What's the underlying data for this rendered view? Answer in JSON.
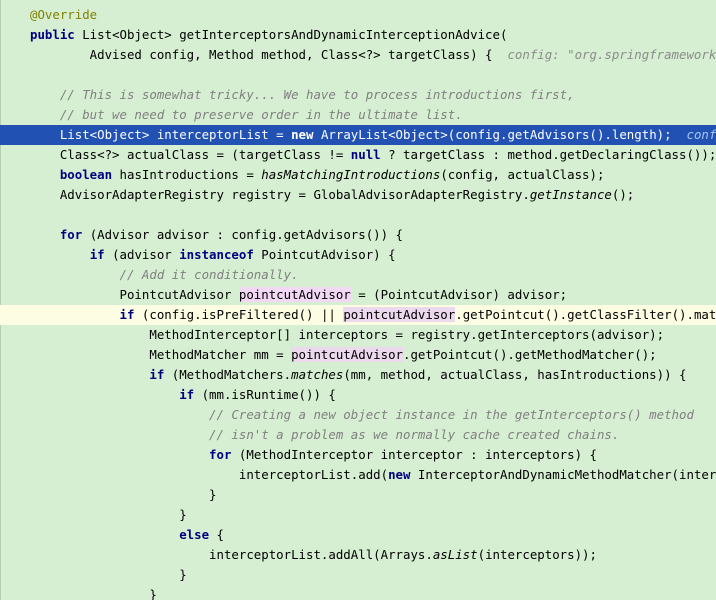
{
  "lines": [
    {
      "segs": [
        {
          "t": "@Override",
          "c": "ann"
        }
      ]
    },
    {
      "segs": [
        {
          "t": "public",
          "c": "kw"
        },
        {
          "t": " List<Object> getInterceptorsAndDynamicInterceptionAdvice("
        }
      ]
    },
    {
      "segs": [
        {
          "t": "        Advised config, Method method, Class<?> targetClass) {  "
        },
        {
          "t": "config: \"org.springframework.aop.framework.ProxyFactory",
          "c": "hint"
        }
      ]
    },
    {
      "segs": []
    },
    {
      "segs": [
        {
          "t": "    // This is somewhat tricky... We have to process introductions first,",
          "c": "cmt"
        }
      ]
    },
    {
      "segs": [
        {
          "t": "    // but we need to preserve order in the ultimate list.",
          "c": "cmt"
        }
      ]
    },
    {
      "state": "current",
      "segs": [
        {
          "t": "    List<Object> interceptorList = "
        },
        {
          "t": "new",
          "c": "kw"
        },
        {
          "t": " ArrayList<Object>(config.getAdvisors()."
        },
        {
          "t": "length",
          "c": "fld"
        },
        {
          "t": ");  "
        },
        {
          "t": "config: \"org.springframework",
          "c": "hint"
        }
      ]
    },
    {
      "segs": [
        {
          "t": "    Class<?> actualClass = (targetClass != "
        },
        {
          "t": "null",
          "c": "kw"
        },
        {
          "t": " ? targetClass : method.getDeclaringClass());"
        }
      ]
    },
    {
      "segs": [
        {
          "t": "    "
        },
        {
          "t": "boolean",
          "c": "kw"
        },
        {
          "t": " hasIntroductions = "
        },
        {
          "t": "hasMatchingIntroductions",
          "c": "it"
        },
        {
          "t": "(config, actualClass);"
        }
      ]
    },
    {
      "segs": [
        {
          "t": "    AdvisorAdapterRegistry registry = GlobalAdvisorAdapterRegistry."
        },
        {
          "t": "getInstance",
          "c": "it"
        },
        {
          "t": "();"
        }
      ]
    },
    {
      "segs": []
    },
    {
      "segs": [
        {
          "t": "    "
        },
        {
          "t": "for",
          "c": "kw"
        },
        {
          "t": " (Advisor advisor : config.getAdvisors()) {"
        }
      ]
    },
    {
      "segs": [
        {
          "t": "        "
        },
        {
          "t": "if",
          "c": "kw"
        },
        {
          "t": " (advisor "
        },
        {
          "t": "instanceof",
          "c": "kw"
        },
        {
          "t": " PointcutAdvisor) {"
        }
      ]
    },
    {
      "segs": [
        {
          "t": "            // Add it conditionally.",
          "c": "cmt"
        }
      ]
    },
    {
      "segs": [
        {
          "t": "            PointcutAdvisor "
        },
        {
          "t": "pointcutAdvisor",
          "c": "usage-c"
        },
        {
          "t": " = (PointcutAdvisor) advisor;"
        }
      ]
    },
    {
      "state": "caret",
      "segs": [
        {
          "t": "            "
        },
        {
          "t": "if",
          "c": "kw"
        },
        {
          "t": " (config.isPreFiltered() || "
        },
        {
          "t": "pointcutAdvisor",
          "c": "usage"
        },
        {
          "t": ".getPointcut().getClassFilter().matches(actualClass)) {"
        }
      ]
    },
    {
      "segs": [
        {
          "t": "                MethodInterceptor[] interceptors = registry.getInterceptors(advisor);"
        }
      ]
    },
    {
      "segs": [
        {
          "t": "                MethodMatcher mm = "
        },
        {
          "t": "pointcutAdvisor",
          "c": "usage"
        },
        {
          "t": ".getPointcut().getMethodMatcher();"
        }
      ]
    },
    {
      "segs": [
        {
          "t": "                "
        },
        {
          "t": "if",
          "c": "kw"
        },
        {
          "t": " (MethodMatchers."
        },
        {
          "t": "matches",
          "c": "it"
        },
        {
          "t": "(mm, method, actualClass, hasIntroductions)) {"
        }
      ]
    },
    {
      "segs": [
        {
          "t": "                    "
        },
        {
          "t": "if",
          "c": "kw"
        },
        {
          "t": " (mm.isRuntime()) {"
        }
      ]
    },
    {
      "segs": [
        {
          "t": "                        // Creating a new object instance in the getInterceptors() method",
          "c": "cmt"
        }
      ]
    },
    {
      "segs": [
        {
          "t": "                        // isn't a problem as we normally cache created chains.",
          "c": "cmt"
        }
      ]
    },
    {
      "segs": [
        {
          "t": "                        "
        },
        {
          "t": "for",
          "c": "kw"
        },
        {
          "t": " (MethodInterceptor interceptor : interceptors) {"
        }
      ]
    },
    {
      "segs": [
        {
          "t": "                            interceptorList.add("
        },
        {
          "t": "new",
          "c": "kw"
        },
        {
          "t": " InterceptorAndDynamicMethodMatcher(interceptor, mm));"
        }
      ]
    },
    {
      "segs": [
        {
          "t": "                        }"
        }
      ]
    },
    {
      "segs": [
        {
          "t": "                    }"
        }
      ]
    },
    {
      "segs": [
        {
          "t": "                    "
        },
        {
          "t": "else",
          "c": "kw"
        },
        {
          "t": " {"
        }
      ]
    },
    {
      "segs": [
        {
          "t": "                        interceptorList.addAll(Arrays."
        },
        {
          "t": "asList",
          "c": "it"
        },
        {
          "t": "(interceptors));"
        }
      ]
    },
    {
      "segs": [
        {
          "t": "                    }"
        }
      ]
    },
    {
      "segs": [
        {
          "t": "                }"
        }
      ]
    }
  ]
}
